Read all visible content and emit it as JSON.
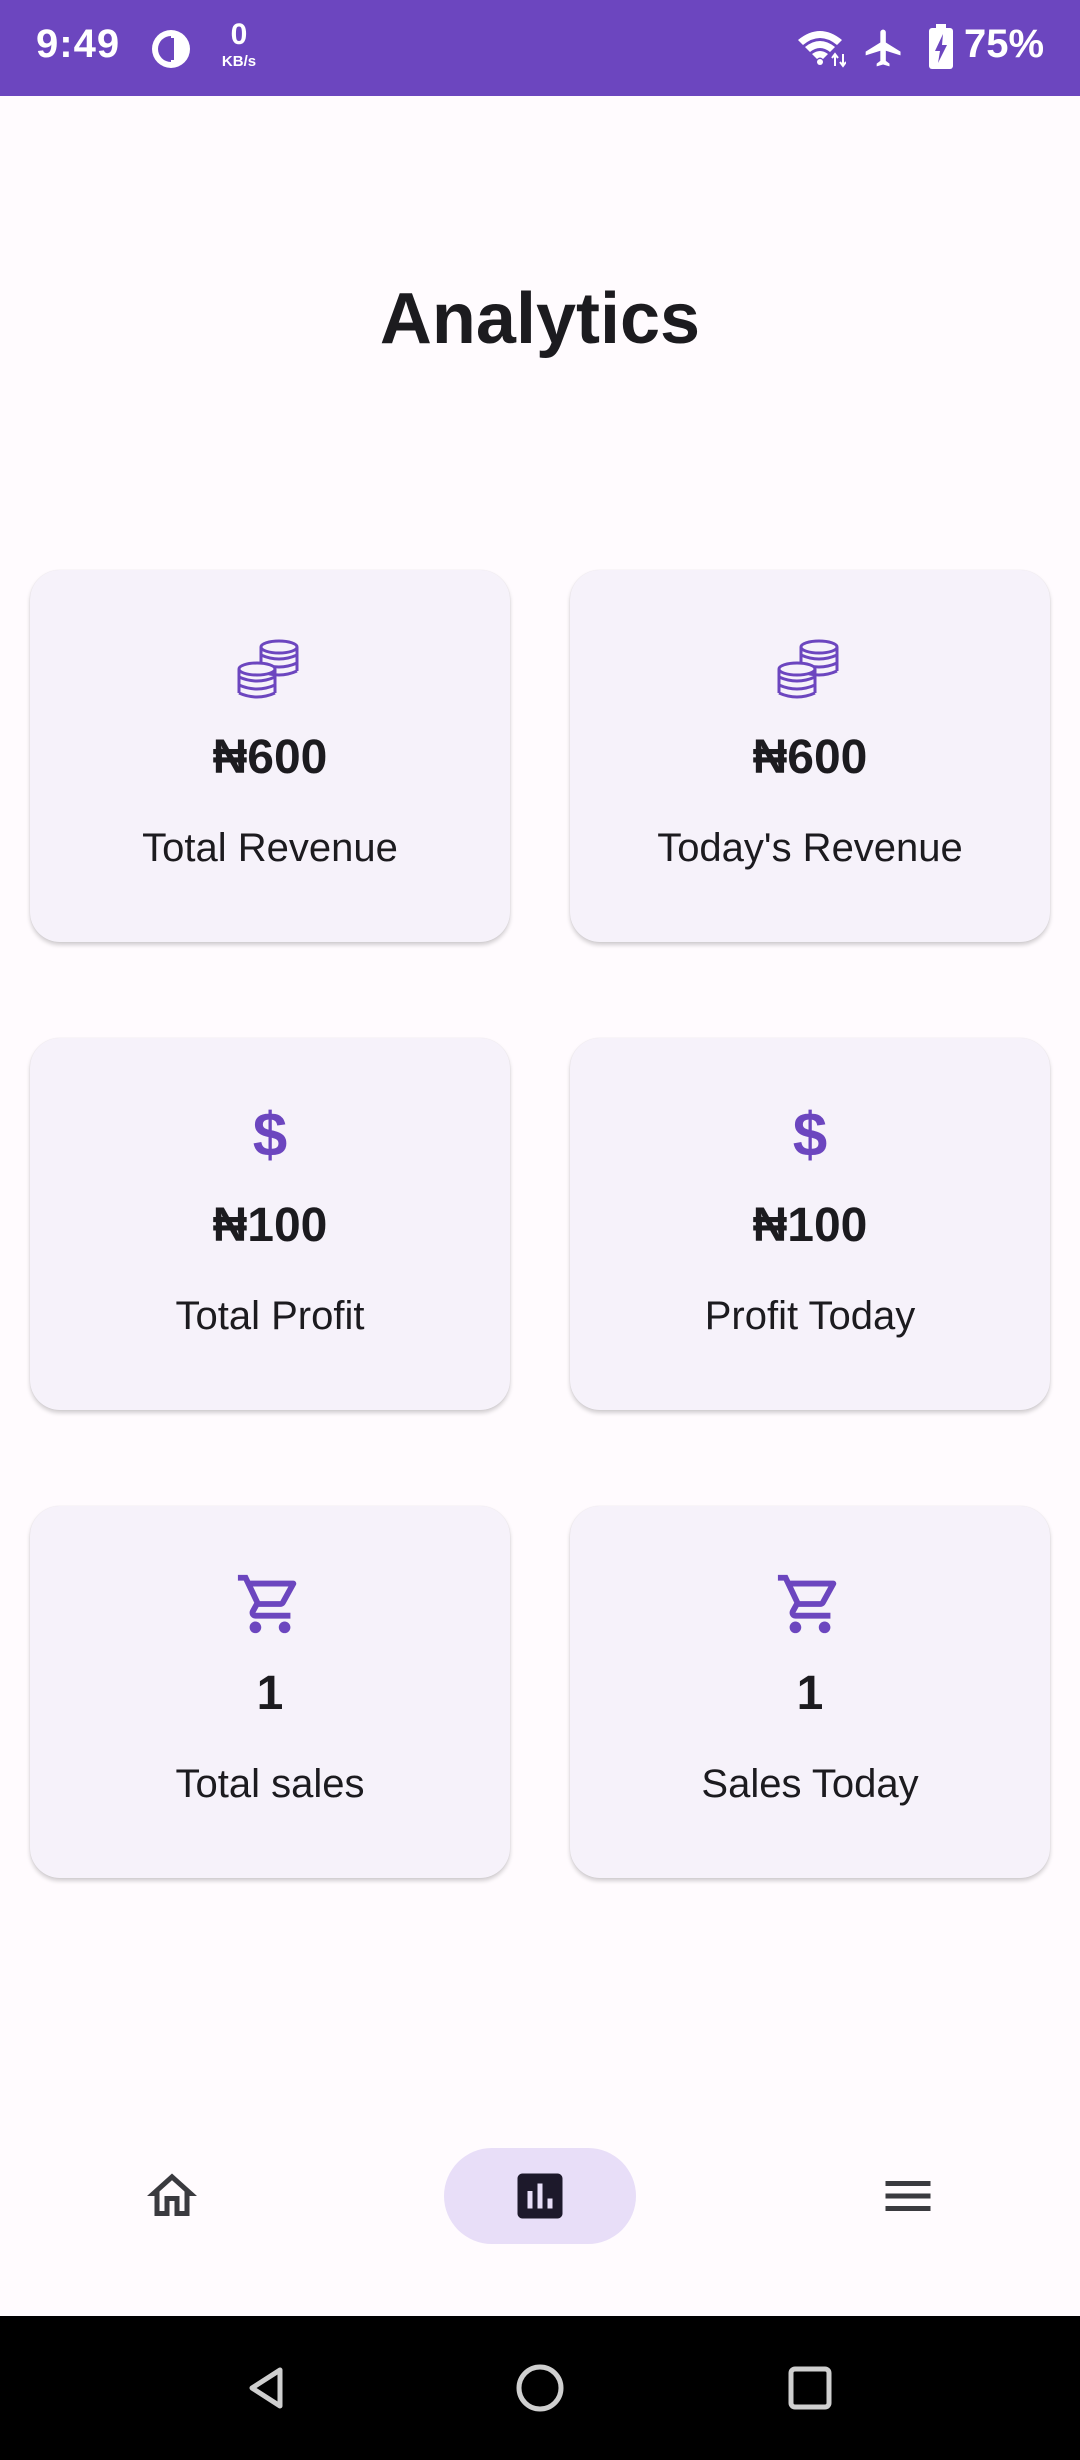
{
  "status_bar": {
    "time": "9:49",
    "net_speed_value": "0",
    "net_speed_unit": "KB/s",
    "battery": "75%",
    "background": "#6c46bf"
  },
  "page": {
    "title": "Analytics"
  },
  "cards": [
    {
      "icon": "coins-icon",
      "value": "₦600",
      "label": "Total Revenue"
    },
    {
      "icon": "coins-icon",
      "value": "₦600",
      "label": "Today's Revenue"
    },
    {
      "icon": "dollar-icon",
      "icon_glyph": "$",
      "value": "₦100",
      "label": "Total Profit"
    },
    {
      "icon": "dollar-icon",
      "icon_glyph": "$",
      "value": "₦100",
      "label": "Profit Today"
    },
    {
      "icon": "cart-icon",
      "value": "1",
      "label": "Total sales"
    },
    {
      "icon": "cart-icon",
      "value": "1",
      "label": "Sales Today"
    }
  ],
  "bottom_nav": {
    "items": [
      {
        "icon": "home-icon",
        "selected": false
      },
      {
        "icon": "analytics-icon",
        "selected": true
      },
      {
        "icon": "menu-icon",
        "selected": false
      }
    ],
    "selected_pill_color": "#e8def8"
  },
  "system_nav": {
    "buttons": [
      "back-icon",
      "home-circle-icon",
      "recents-icon"
    ]
  },
  "colors": {
    "accent": "#6c46bf",
    "card_background": "#f6f2fa",
    "page_background": "#fffbfe"
  }
}
